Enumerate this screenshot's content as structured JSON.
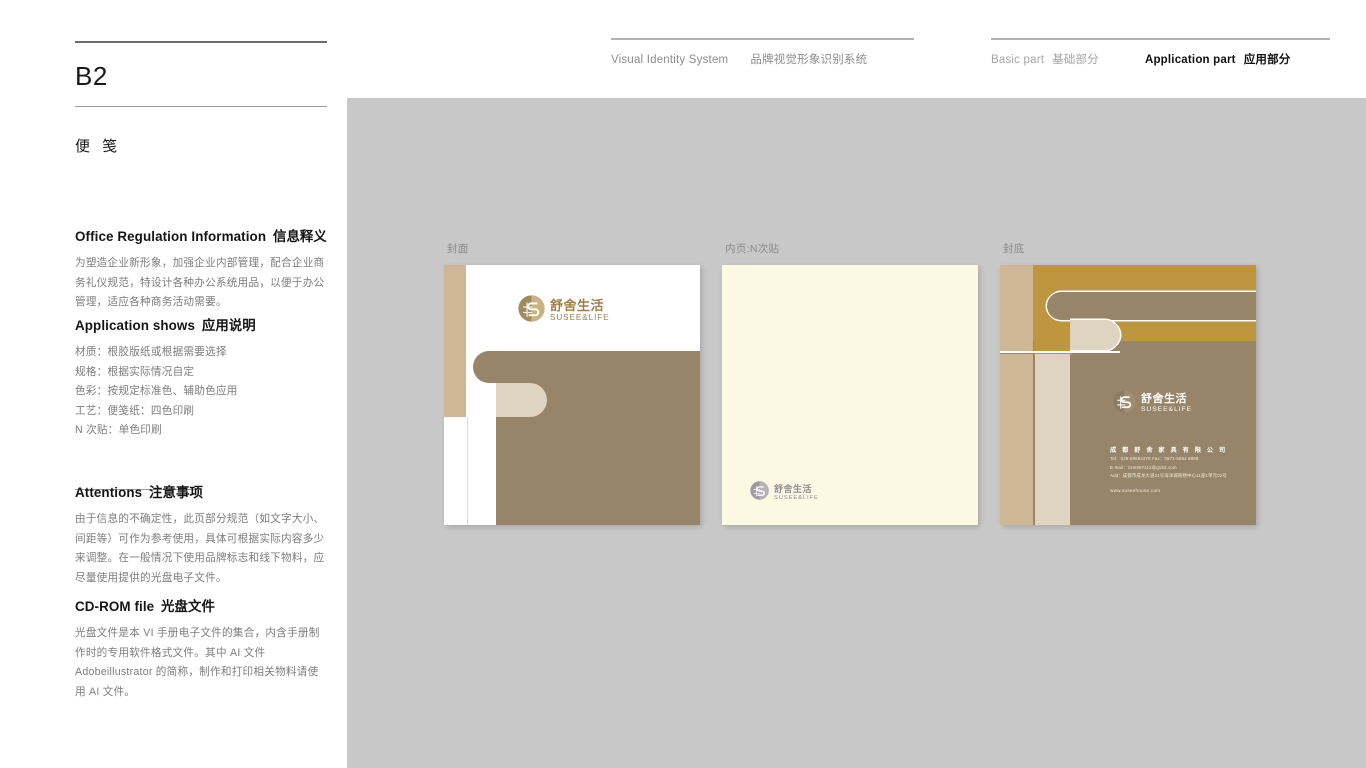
{
  "header": {
    "vis_en": "Visual Identity System",
    "vis_cn": "品牌视觉形象识别系统",
    "basic_en": "Basic part",
    "basic_cn": "基础部分",
    "app_en": "Application part",
    "app_cn": "应用部分"
  },
  "left": {
    "code": "B2",
    "subtitle": "便 笺",
    "info": {
      "heading_en": "Office Regulation Information",
      "heading_cn": "信息释义",
      "body": "为塑造企业新形象，加强企业内部管理，配合企业商务礼仪规范，特设计各种办公系统用品，以便于办公管理，适应各种商务活动需要。"
    },
    "application": {
      "heading_en": "Application shows",
      "heading_cn": "应用说明",
      "items": [
        "材质：根胶版纸或根据需要选择",
        "规格：根据实际情况自定",
        "色彩：按规定标准色、辅助色应用",
        "工艺：便笺纸：四色印刷",
        "N 次贴：单色印刷"
      ]
    },
    "attentions": {
      "heading_en": "Attentions",
      "heading_cn": "注意事项",
      "body": "由于信息的不确定性，此页部分规范（如文字大小、间距等）可作为参考使用，具体可根据实际内容多少来调整。在一般情况下使用品牌标志和线下物料，应尽量使用提供的光盘电子文件。"
    },
    "cdrom": {
      "heading_en": "CD-ROM file",
      "heading_cn": "光盘文件",
      "body": "光盘文件是本 VI 手册电子文件的集合，内含手册制作时的专用软件格式文件。其中 AI 文件 Adobeillustrator 的简称，制作和打印相关物料请使用 AI 文件。"
    }
  },
  "mockups": {
    "cover_label": "封面",
    "inner_label": "内页:N次贴",
    "back_label": "封底"
  },
  "brand": {
    "name_cn": "舒舍生活",
    "name_en": "SUSEE&LIFE",
    "company": "成 都 舒 舍 家 具 有 限 公 司",
    "tel_line": "Tel：028-88692278    Fax：0571-6554 8888",
    "email_line": "E-mail：zxm807112@g163.com",
    "addr_line": "Add：成都市成龙大道21号海洋城购物中心11座1单元02号",
    "website": "www.suseehouse.com"
  },
  "colors": {
    "canvas_gray": "#c8c8c8",
    "brand_brown": "#988468",
    "brand_gold": "#bf9640",
    "brand_tan": "#cdb795",
    "brand_beige": "#ded4c0",
    "paper_cream": "#fcf8e2"
  }
}
